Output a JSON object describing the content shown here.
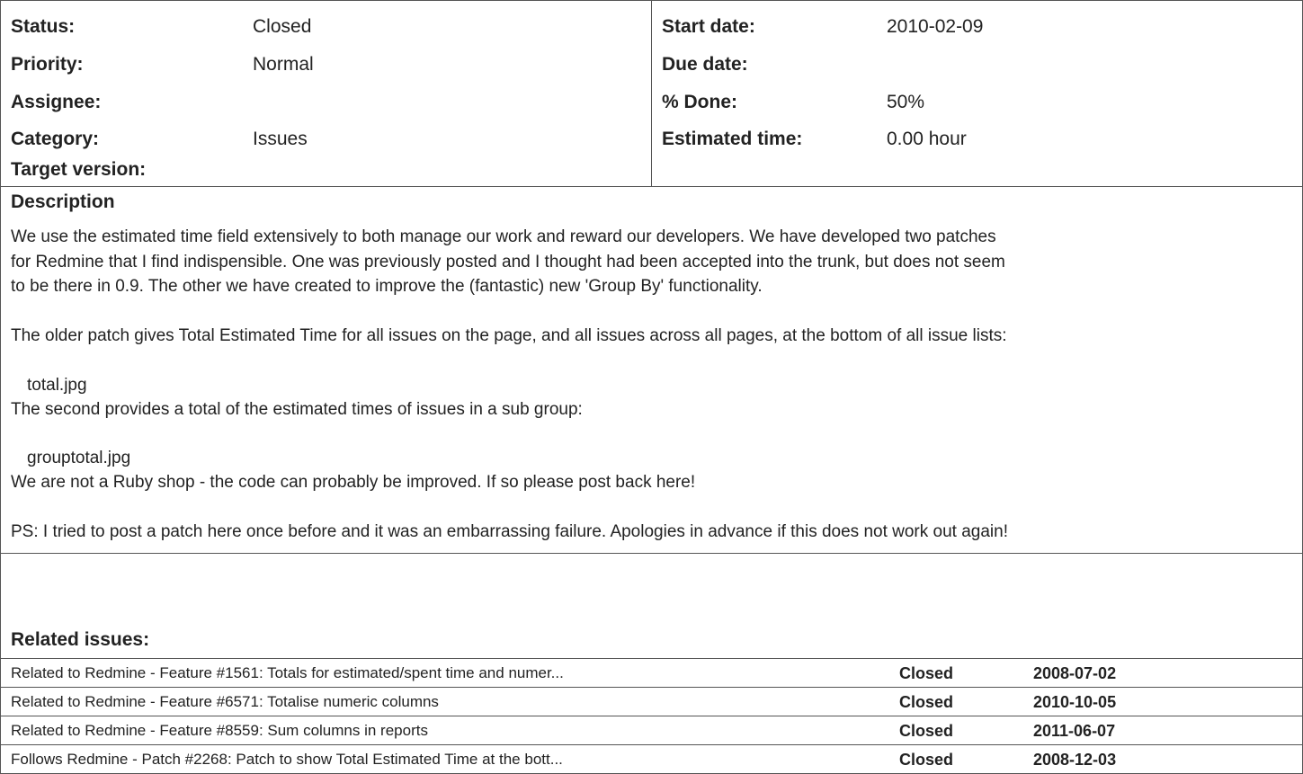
{
  "attributes": {
    "left": [
      {
        "label": "Status:",
        "value": "Closed"
      },
      {
        "label": "Priority:",
        "value": "Normal"
      },
      {
        "label": "Assignee:",
        "value": ""
      },
      {
        "label": "Category:",
        "value": "Issues"
      },
      {
        "label": "Target version:",
        "value": ""
      }
    ],
    "right": [
      {
        "label": "Start date:",
        "value": "2010-02-09"
      },
      {
        "label": "Due date:",
        "value": ""
      },
      {
        "label": "% Done:",
        "value": "50%"
      },
      {
        "label": "Estimated time:",
        "value": "0.00 hour"
      }
    ]
  },
  "description": {
    "title": "Description",
    "lines": [
      "We use the estimated time field extensively to both manage our work and reward our developers. We have developed two patches",
      "for Redmine that I find indispensible. One was previously posted and I thought had been accepted into the trunk, but does not seem",
      "to be there in 0.9. The other we have created to improve the (fantastic) new 'Group By' functionality.",
      "The older patch gives Total Estimated Time for all issues on the page, and all issues across all pages, at the bottom of all issue lists:",
      "The second provides a total of the estimated times of issues in a sub group:",
      "We are not a Ruby shop - the code can probably be improved. If so please post back here!",
      "PS: I tried to post a patch here once before and it was an embarrassing failure. Apologies in advance if this does not work out again!"
    ],
    "attachments": [
      "total.jpg",
      "grouptotal.jpg"
    ]
  },
  "related": {
    "title": "Related issues:",
    "rows": [
      {
        "subject": "Related to Redmine - Feature #1561: Totals for estimated/spent time and numer...",
        "status": "Closed",
        "date": "2008-07-02"
      },
      {
        "subject": "Related to Redmine - Feature #6571: Totalise numeric columns",
        "status": "Closed",
        "date": "2010-10-05"
      },
      {
        "subject": "Related to Redmine - Feature #8559: Sum columns in reports",
        "status": "Closed",
        "date": "2011-06-07"
      },
      {
        "subject": "Follows Redmine - Patch #2268: Patch to show Total Estimated Time at the bott...",
        "status": "Closed",
        "date": "2008-12-03"
      }
    ]
  }
}
